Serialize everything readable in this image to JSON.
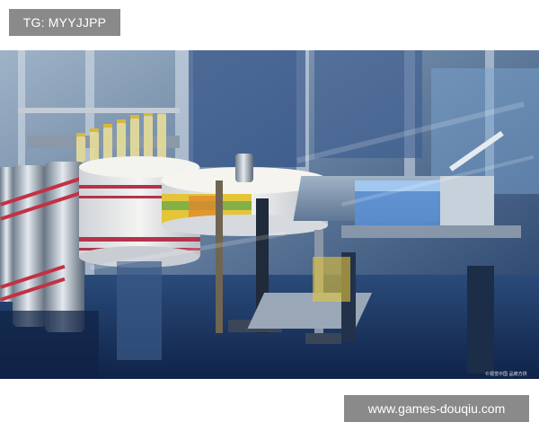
{
  "watermark_top": "TG: MYYJJPP",
  "watermark_bottom": "www.games-douqiu.com",
  "photo_credit": "©视觉中国 品牌方供",
  "photo": {
    "subject": "bottling-labeling-machine",
    "palette": {
      "steel": "#b9c4cf",
      "deep_blue": "#1e3a6a",
      "label_red": "#b3344a",
      "label_yellow": "#e4c53a",
      "sky_blue": "#7fb4e6"
    }
  }
}
